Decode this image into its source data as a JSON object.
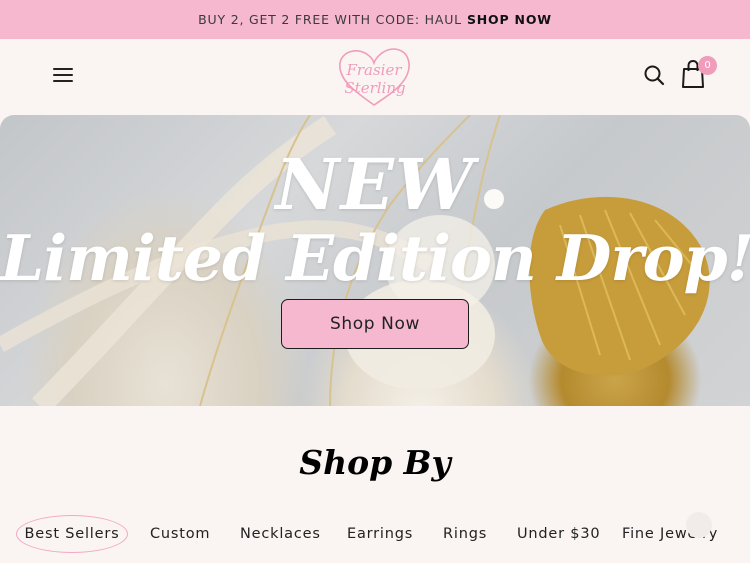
{
  "announcement": {
    "text": "BUY 2, GET 2 FREE WITH CODE: HAUL",
    "link": "SHOP NOW"
  },
  "header": {
    "logo_line1": "Frasier",
    "logo_line2": "Sterling",
    "cart_count": "0",
    "icons": {
      "menu": "hamburger-menu-icon",
      "search": "search-icon",
      "cart": "shopping-bag-icon"
    }
  },
  "hero": {
    "line1": "NEW",
    "line2": "Limited Edition Drop!",
    "cta": "Shop Now"
  },
  "shop_by": {
    "title": "Shop By",
    "categories": [
      {
        "label": "Best Sellers",
        "active": true
      },
      {
        "label": "Custom"
      },
      {
        "label": "Necklaces"
      },
      {
        "label": "Earrings"
      },
      {
        "label": "Rings"
      },
      {
        "label": "Under $30"
      },
      {
        "label": "Fine Jewelry"
      }
    ]
  },
  "colors": {
    "accent_pink": "#f6b8cf",
    "logo_pink": "#f09cbb",
    "background": "#faf4f2"
  }
}
